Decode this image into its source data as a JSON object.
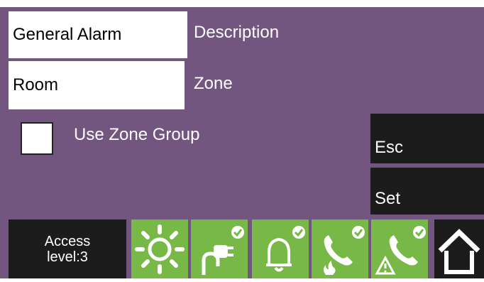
{
  "fields": {
    "general_alarm": "General Alarm",
    "description_label": "Description",
    "room": "Room",
    "zone_label": "Zone"
  },
  "checkbox": {
    "label": "Use Zone Group",
    "checked": false
  },
  "buttons": {
    "esc": "Esc",
    "set": "Set"
  },
  "status": {
    "access_line1": "Access",
    "access_line2": "level:3",
    "icons": [
      "sun-icon",
      "power-plug-check-icon",
      "bell-check-icon",
      "phone-fire-check-icon",
      "phone-warning-check-icon",
      "home-icon"
    ]
  },
  "colors": {
    "background": "#735680",
    "dark": "#1c1c1c",
    "green": "#78b846",
    "white": "#ffffff"
  }
}
